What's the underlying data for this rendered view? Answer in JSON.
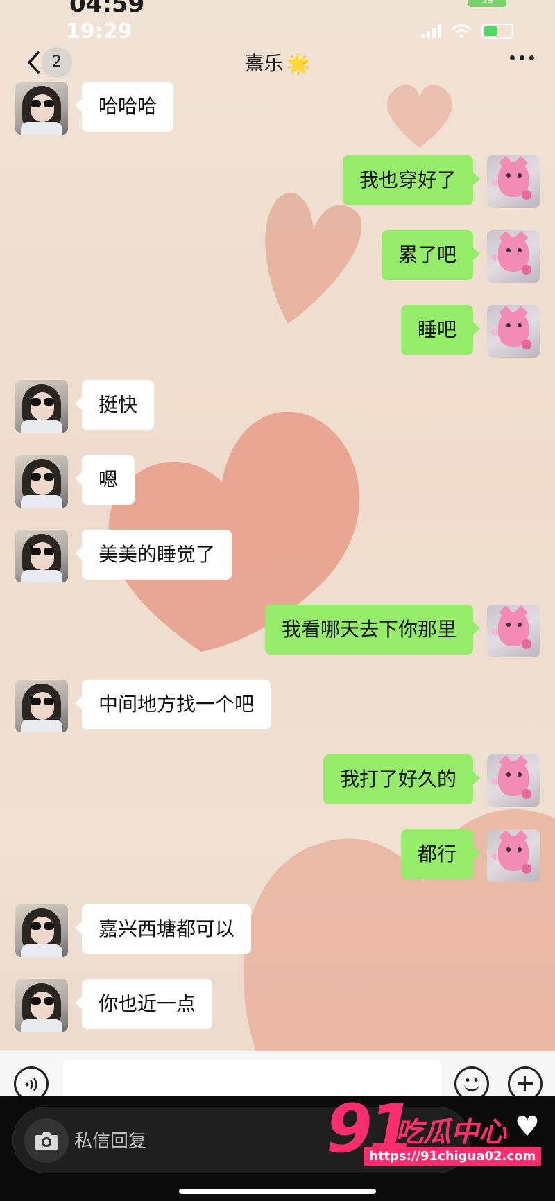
{
  "status_bar": {
    "outer_time": "04:59",
    "outer_battery": "39",
    "time": "19:29"
  },
  "header": {
    "unread_count": "2",
    "title": "熹乐",
    "title_emoji": "🌟"
  },
  "messages": [
    {
      "side": "left",
      "text": "哈哈哈"
    },
    {
      "side": "right",
      "text": "我也穿好了"
    },
    {
      "side": "right",
      "text": "累了吧"
    },
    {
      "side": "right",
      "text": "睡吧"
    },
    {
      "side": "left",
      "text": "挺快"
    },
    {
      "side": "left",
      "text": "嗯"
    },
    {
      "side": "left",
      "text": "美美的睡觉了"
    },
    {
      "side": "right",
      "text": "我看哪天去下你那里"
    },
    {
      "side": "left",
      "text": "中间地方找一个吧"
    },
    {
      "side": "right",
      "text": "我打了好久的"
    },
    {
      "side": "right",
      "text": "都行"
    },
    {
      "side": "left",
      "text": "嘉兴西塘都可以"
    },
    {
      "side": "left",
      "text": "你也近一点"
    }
  ],
  "composer": {
    "placeholder": ""
  },
  "overlay": {
    "reply_placeholder": "私信回复",
    "watermark_number": "91",
    "watermark_brand": "吃瓜中心",
    "watermark_url": "https://91chigua02.com"
  },
  "colors": {
    "sent_bubble": "#95ec69",
    "received_bubble": "#ffffff",
    "background": "#efe0d2",
    "watermark": "#ff2d6f"
  },
  "icons": {
    "back": "chevron-left-icon",
    "more": "more-dots-icon",
    "voice": "voice-icon",
    "emoji": "emoji-icon",
    "add": "plus-icon",
    "camera": "camera-icon"
  }
}
